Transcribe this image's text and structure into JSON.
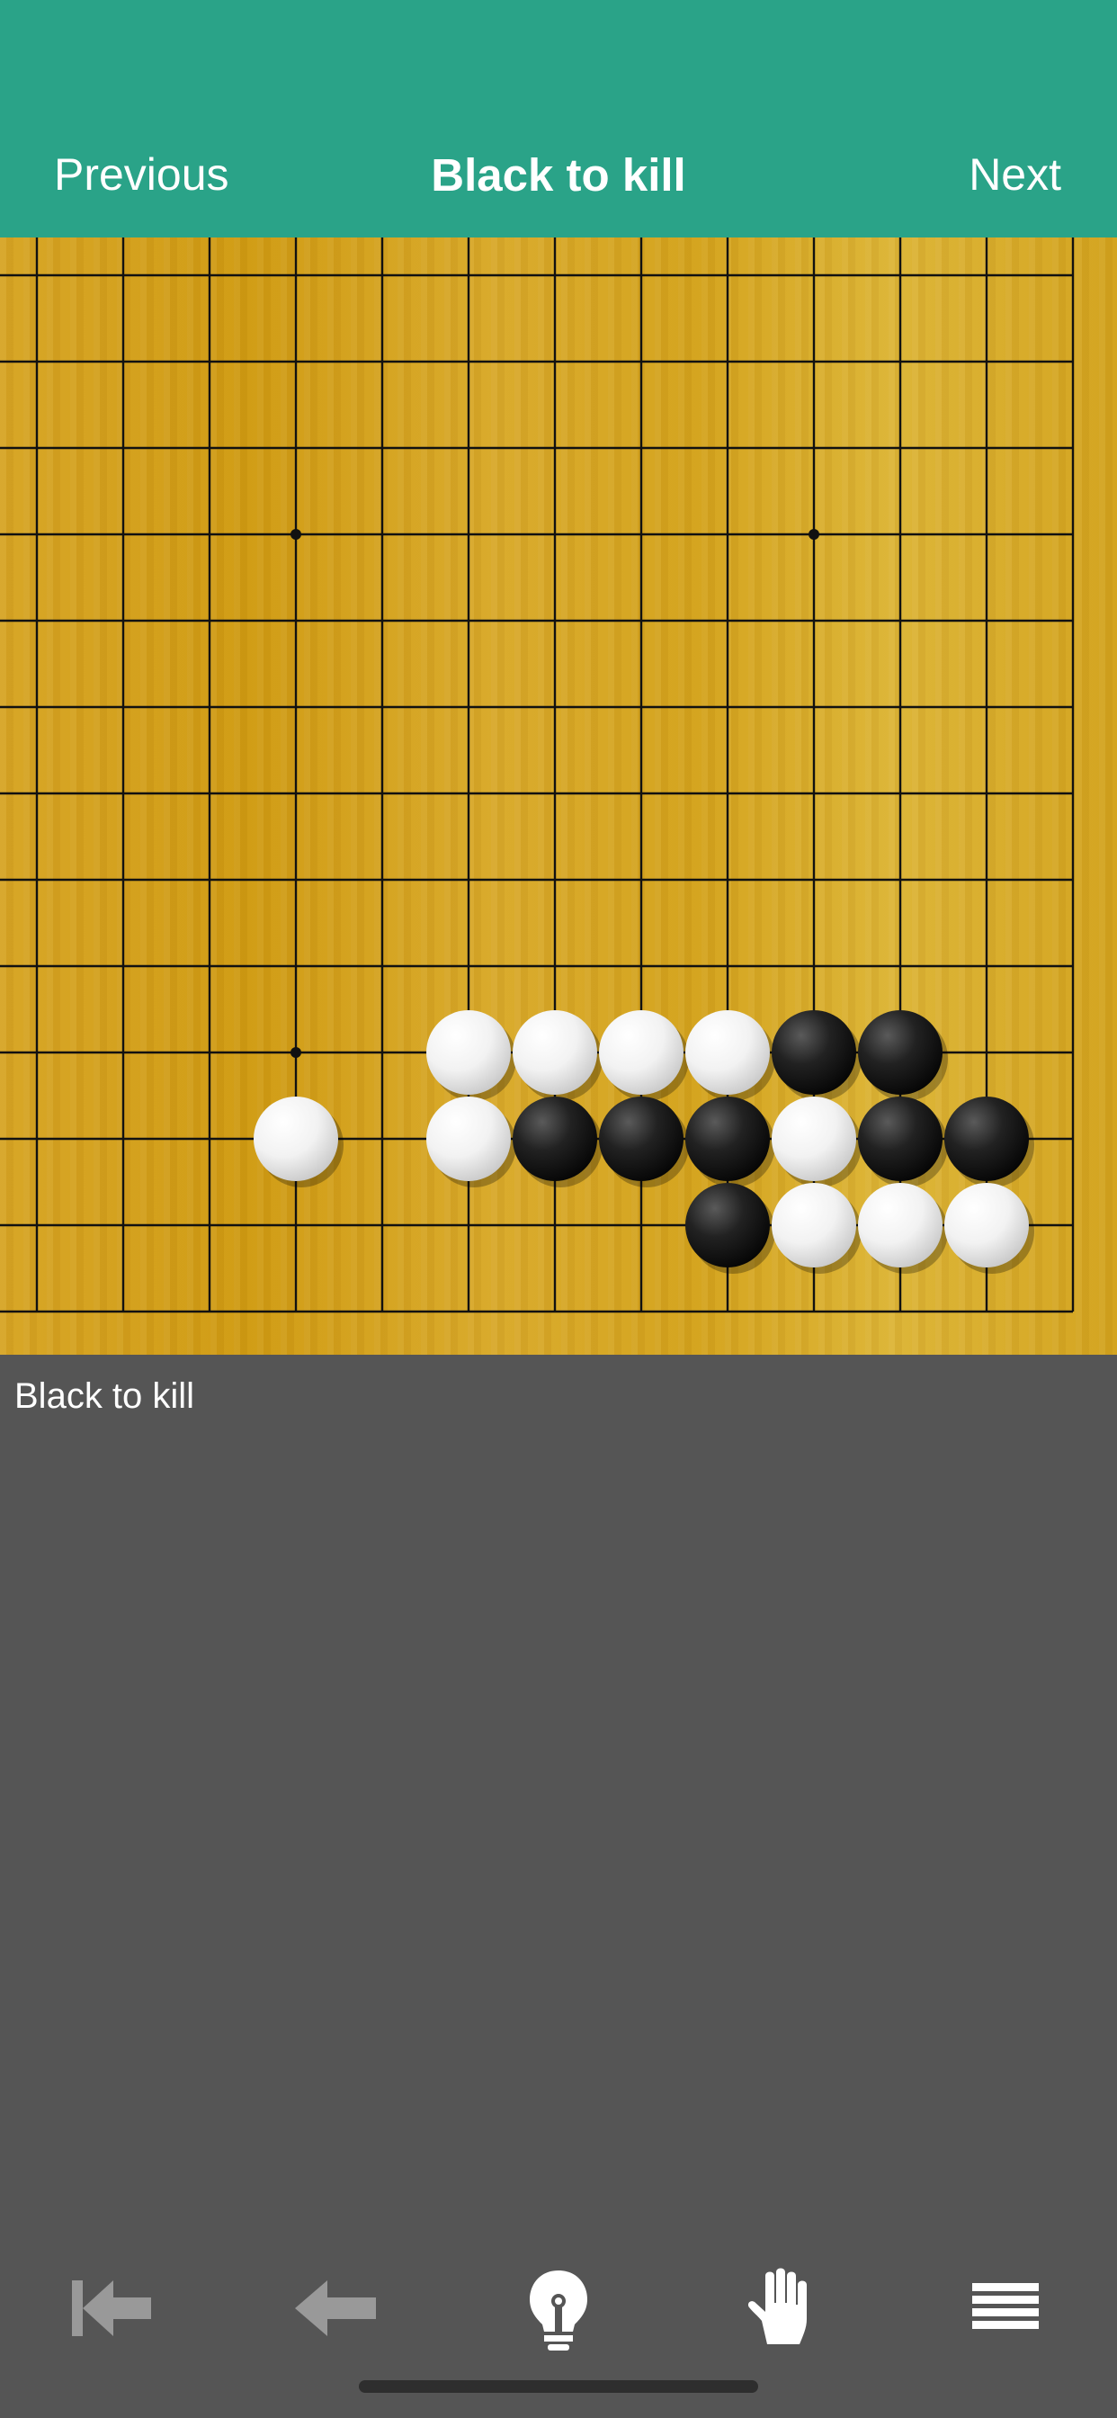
{
  "header": {
    "previous_label": "Previous",
    "title": "Black to kill",
    "next_label": "Next",
    "background": "#2aa388"
  },
  "board": {
    "visible_columns": 13,
    "visible_rows": 13,
    "star_points": [
      [
        3,
        3
      ],
      [
        9,
        3
      ],
      [
        3,
        9
      ]
    ],
    "stones": [
      {
        "color": "white",
        "col": 5,
        "row": 9
      },
      {
        "color": "white",
        "col": 6,
        "row": 9
      },
      {
        "color": "white",
        "col": 7,
        "row": 9
      },
      {
        "color": "white",
        "col": 8,
        "row": 9
      },
      {
        "color": "black",
        "col": 9,
        "row": 9
      },
      {
        "color": "black",
        "col": 10,
        "row": 9
      },
      {
        "color": "white",
        "col": 3,
        "row": 10
      },
      {
        "color": "white",
        "col": 5,
        "row": 10
      },
      {
        "color": "black",
        "col": 6,
        "row": 10
      },
      {
        "color": "black",
        "col": 7,
        "row": 10
      },
      {
        "color": "black",
        "col": 8,
        "row": 10
      },
      {
        "color": "white",
        "col": 9,
        "row": 10
      },
      {
        "color": "black",
        "col": 10,
        "row": 10
      },
      {
        "color": "black",
        "col": 11,
        "row": 10
      },
      {
        "color": "black",
        "col": 8,
        "row": 11
      },
      {
        "color": "white",
        "col": 9,
        "row": 11
      },
      {
        "color": "white",
        "col": 10,
        "row": 11
      },
      {
        "color": "white",
        "col": 11,
        "row": 11
      }
    ]
  },
  "comment": "Black to kill",
  "toolbar": {
    "icons": [
      "first-move-icon",
      "back-icon",
      "hint-lightbulb-icon",
      "hand-pointer-icon",
      "menu-icon"
    ],
    "icon_color": "#999999",
    "hint_icon_color": "#ffffff"
  }
}
